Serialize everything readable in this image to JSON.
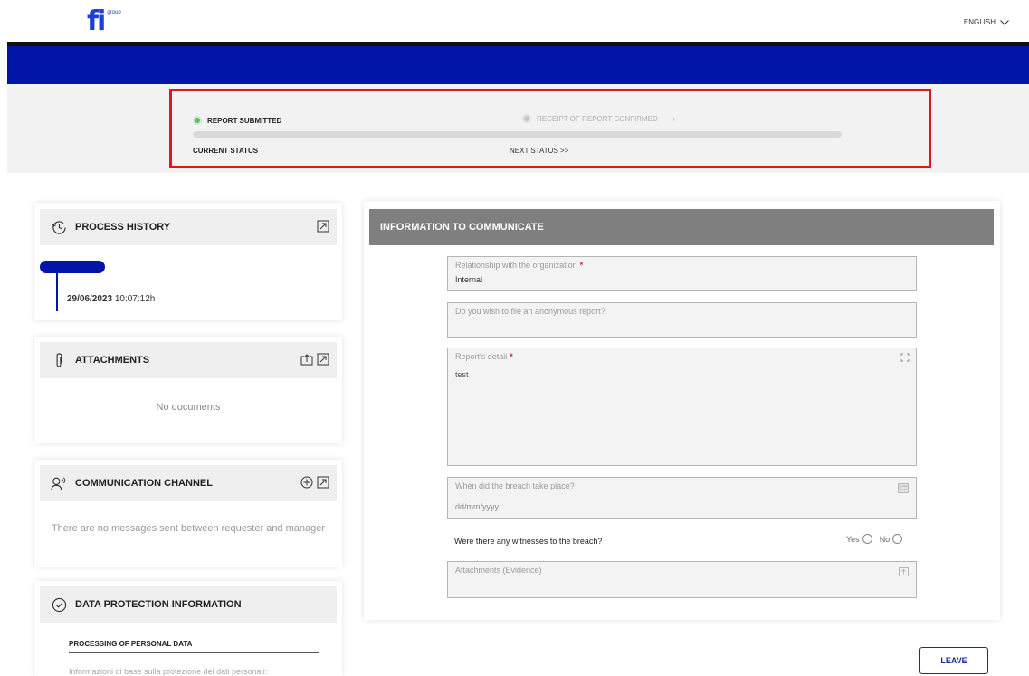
{
  "header": {
    "logo_mark": "fi",
    "logo_sub": "group",
    "language": "ENGLISH"
  },
  "status": {
    "current_step": "REPORT SUBMITTED",
    "next_step": "RECEIPT OF REPORT CONFIRMED",
    "next_arrow": "⟶",
    "current_label": "CURRENT STATUS",
    "next_label": "NEXT STATUS >>",
    "current_color": "#5fc25f",
    "highlight_color": "#e01818"
  },
  "sidebar": {
    "history": {
      "title": "PROCESS HISTORY",
      "date": "29/06/2023",
      "time": "10:07:12h"
    },
    "attachments": {
      "title": "ATTACHMENTS",
      "empty": "No documents"
    },
    "communication": {
      "title": "COMMUNICATION CHANNEL",
      "empty": "There are no messages sent between requester and manager"
    },
    "data_protection": {
      "title": "DATA PROTECTION INFORMATION",
      "subtitle": "PROCESSING OF PERSONAL DATA",
      "text": "Informazioni di base sulla protezione dei dati personali:"
    }
  },
  "form": {
    "title": "INFORMATION TO COMMUNICATE",
    "relationship": {
      "label": "Relationship with the organization",
      "value": "Internal"
    },
    "anonymous": {
      "label": "Do you wish to file an anonymous report?"
    },
    "detail": {
      "label": "Report's detail",
      "value": "test"
    },
    "breach_date": {
      "label": "When did the breach take place?",
      "placeholder": "dd/mm/yyyy"
    },
    "witnesses": {
      "question": "Were there any witnesses to the breach?",
      "yes": "Yes",
      "no": "No"
    },
    "evidence": {
      "label": "Attachments (Evidence)"
    }
  },
  "actions": {
    "leave": "LEAVE"
  },
  "colors": {
    "brand_blue": "#0014a8",
    "form_header": "#7f7f7f"
  }
}
